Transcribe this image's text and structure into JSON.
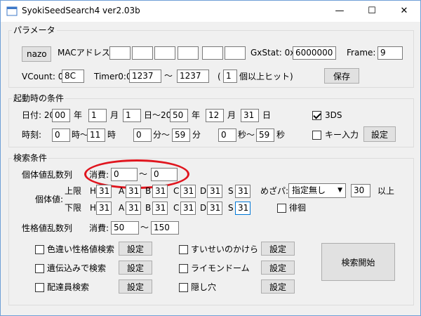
{
  "window": {
    "title": "SyokiSeedSearch4 ver2.03b",
    "min_glyph": "—",
    "max_glyph": "☐",
    "close_glyph": "✕"
  },
  "params": {
    "group_title": "パラメータ",
    "nazo_button": "nazo",
    "mac_label": "MACアドレス:",
    "mac_values": [
      "",
      "",
      "",
      "",
      "",
      ""
    ],
    "gxstat_label": "GxStat: 0x",
    "gxstat_value": "6000000",
    "frame_label": "Frame:",
    "frame_value": "9",
    "vcount_label": "VCount: 0x",
    "vcount_value": "8C",
    "timer_label": "Timer0:0x",
    "timer_from": "1237",
    "timer_tilde": "〜",
    "timer_to": "1237",
    "paren_open": "(",
    "hit_count": "1",
    "hit_label": "個以上ヒット)",
    "save_button": "保存"
  },
  "startup": {
    "group_title": "起動時の条件",
    "date_label": "日付: 20",
    "year_from": "00",
    "year_unit": "年",
    "month_from": "1",
    "month_unit": "月",
    "day_from": "1",
    "day_tilde_prefix": "日〜20",
    "year_to": "50",
    "year_unit2": "年",
    "month_to": "12",
    "month_unit2": "月",
    "day_to": "31",
    "day_unit2": "日",
    "ds_label": "3DS",
    "time_label": "時刻:",
    "hour_from": "0",
    "hour_tilde": "時〜",
    "hour_to": "11",
    "hour_unit": "時",
    "min_from": "0",
    "min_tilde": "分〜",
    "min_to": "59",
    "min_unit": "分",
    "sec_from": "0",
    "sec_tilde": "秒〜",
    "sec_to": "59",
    "sec_unit": "秒",
    "key_label": "キー入力",
    "settings_button": "設定"
  },
  "search": {
    "group_title": "検索条件",
    "iv_rng_label": "個体値乱数列",
    "consume_label": "消費:",
    "consume_from": "0",
    "consume_tilde": "〜",
    "consume_to": "0",
    "iv_label": "個体値:",
    "upper_label": "上限",
    "lower_label": "下限",
    "stat_letters": [
      "H",
      "A",
      "B",
      "C",
      "D",
      "S"
    ],
    "upper_values": [
      "31",
      "31",
      "31",
      "31",
      "31",
      "31"
    ],
    "lower_values": [
      "31",
      "31",
      "31",
      "31",
      "31",
      "31"
    ],
    "mezapa_label": "めざパ:",
    "mezapa_selected": "指定無し",
    "mezapa_power": "30",
    "mezapa_suffix": "以上",
    "wander_label": "徘徊",
    "nature_rng_label": "性格値乱数列",
    "nature_consume_label": "消費:",
    "nature_from": "50",
    "nature_tilde": "〜",
    "nature_to": "150",
    "options_left": [
      {
        "label": "色違い性格値検索",
        "button": "設定"
      },
      {
        "label": "遺伝込みで検索",
        "button": "設定"
      },
      {
        "label": "配達員検索",
        "button": "設定"
      }
    ],
    "options_right": [
      {
        "label": "すいせいのかけら",
        "button": "設定"
      },
      {
        "label": "ライモンドーム",
        "button": "設定"
      },
      {
        "label": "隠し穴",
        "button": "設定"
      }
    ],
    "start_button": "検索開始"
  }
}
